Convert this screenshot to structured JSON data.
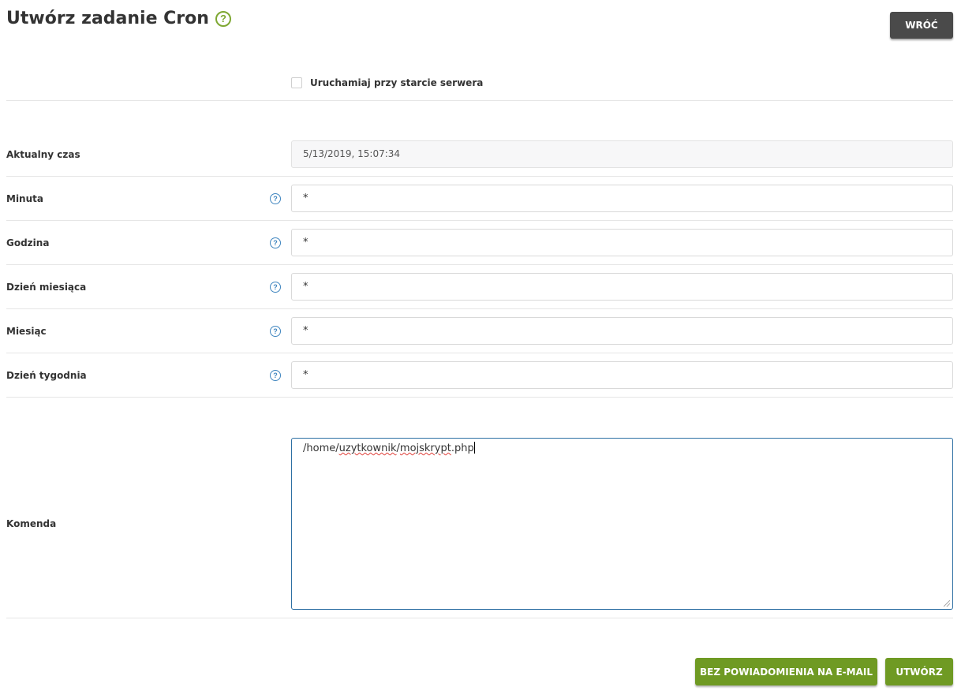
{
  "header": {
    "title": "Utwórz zadanie Cron",
    "help_icon": "question-circle-icon",
    "back_label": "WRÓĆ"
  },
  "startup": {
    "label": "Uruchamiaj przy starcie serwera",
    "checked": false
  },
  "fields": {
    "current_time": {
      "label": "Aktualny czas",
      "value": "5/13/2019, 15:07:34"
    },
    "minute": {
      "label": "Minuta",
      "value": "*"
    },
    "hour": {
      "label": "Godzina",
      "value": "*"
    },
    "day_of_month": {
      "label": "Dzień miesiąca",
      "value": "*"
    },
    "month": {
      "label": "Miesiąc",
      "value": "*"
    },
    "day_of_week": {
      "label": "Dzień tygodnia",
      "value": "*"
    },
    "command": {
      "label": "Komenda",
      "value_prefix": "/home/",
      "value_word1": "uzytkownik",
      "value_sep": "/",
      "value_word2": "mojskrypt",
      "value_suffix": ".php"
    }
  },
  "actions": {
    "no_email_label": "BEZ POWIADOMIENIA NA E-MAIL",
    "create_label": "UTWÓRZ"
  },
  "colors": {
    "accent_green": "#6f9a23",
    "help_blue": "#3f85bf",
    "dark_button": "#4a4a4a"
  }
}
